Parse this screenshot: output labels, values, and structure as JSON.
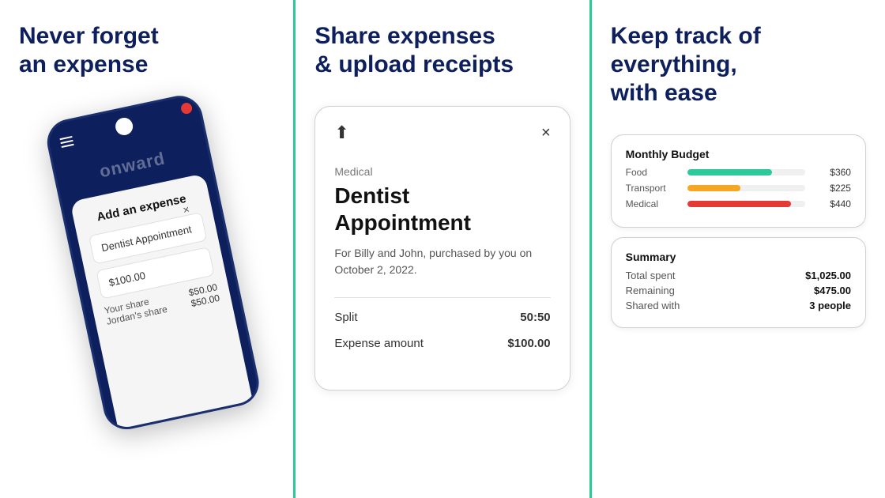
{
  "panel1": {
    "title_line1": "Never forget",
    "title_line2": "an expense",
    "phone": {
      "brand": "onward",
      "modal_title": "Add an expense",
      "field1": "Dentist Appointment",
      "field2": "$100.00",
      "label_your_share": "Your share",
      "label_jordan_share": "Jordan's share",
      "your_share_amount": "$50.00",
      "jordan_share_amount": "$50.00"
    }
  },
  "panel2": {
    "title_line1": "Share expenses",
    "title_line2": "& upload receipts",
    "receipt": {
      "share_icon": "⬆",
      "close_icon": "×",
      "category": "Medical",
      "title": "Dentist Appointment",
      "description": "For Billy and John, purchased by you on October 2, 2022.",
      "split_label": "Split",
      "split_value": "50:50",
      "amount_label": "Expense amount",
      "amount_value": "$100.00"
    }
  },
  "panel3": {
    "title_line1": "Keep track of",
    "title_line2": "everything,",
    "title_line3": "with ease",
    "cards": [
      {
        "title": "Monthly Budget",
        "bars": [
          {
            "label": "Food",
            "pct": 72,
            "color": "#2cc99a",
            "amount": "$360"
          },
          {
            "label": "Transport",
            "pct": 45,
            "color": "#f5a623",
            "amount": "$225"
          },
          {
            "label": "Medical",
            "pct": 88,
            "color": "#e53935",
            "amount": "$440"
          }
        ]
      },
      {
        "title": "Summary",
        "rows": [
          {
            "label": "Total spent",
            "val": "$1,025.00"
          },
          {
            "label": "Remaining",
            "val": "$475.00"
          },
          {
            "label": "Shared with",
            "val": "3 people"
          }
        ]
      }
    ],
    "accent_color": "#2cc99a"
  },
  "divider_color": "#2cc99a"
}
